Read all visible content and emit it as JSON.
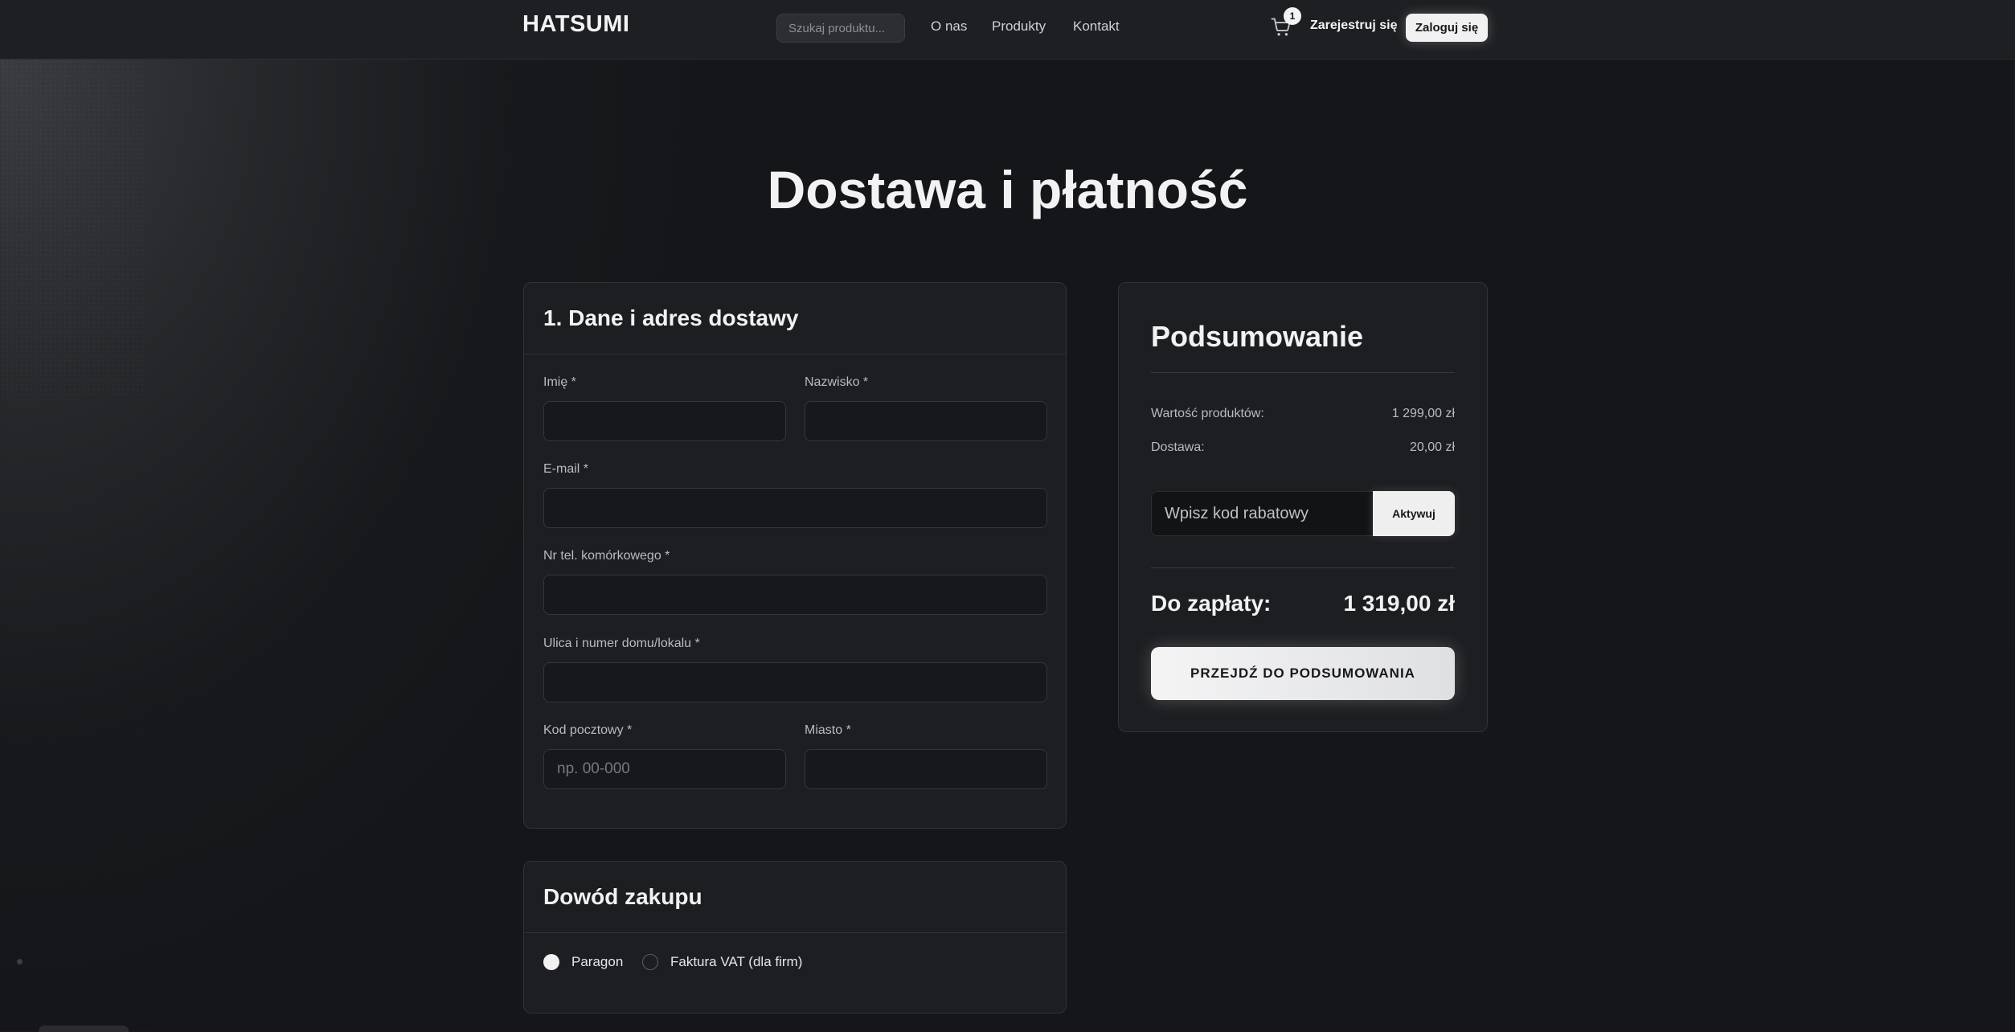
{
  "header": {
    "logo": "HATSUMI",
    "search_placeholder": "Szukaj produktu...",
    "nav": [
      "O nas",
      "Produkty",
      "Kontakt"
    ],
    "cart_icon": "cart-icon",
    "cart_count": "1",
    "register_label": "Zarejestruj się",
    "login_label": "Zaloguj się"
  },
  "page": {
    "title": "Dostawa i płatność"
  },
  "delivery": {
    "title": "1. Dane i adres dostawy",
    "fields": {
      "first_name": {
        "label": "Imię *",
        "value": "",
        "placeholder": ""
      },
      "last_name": {
        "label": "Nazwisko *",
        "value": "",
        "placeholder": ""
      },
      "email": {
        "label": "E-mail *",
        "value": "",
        "placeholder": ""
      },
      "phone": {
        "label": "Nr tel. komórkowego *",
        "value": "",
        "placeholder": ""
      },
      "street": {
        "label": "Ulica i numer domu/lokalu *",
        "value": "",
        "placeholder": ""
      },
      "postal": {
        "label": "Kod pocztowy *",
        "value": "",
        "placeholder": "np. 00-000"
      },
      "city": {
        "label": "Miasto *",
        "value": "",
        "placeholder": ""
      }
    }
  },
  "proof": {
    "title": "Dowód zakupu",
    "options": [
      {
        "label": "Paragon",
        "selected": true
      },
      {
        "label": "Faktura VAT (dla firm)",
        "selected": false
      }
    ]
  },
  "summary": {
    "title": "Podsumowanie",
    "products_label": "Wartość produktów:",
    "products_value": "1 299,00 zł",
    "shipping_label": "Dostawa:",
    "shipping_value": "20,00 zł",
    "coupon_placeholder": "Wpisz kod rabatowy",
    "coupon_button": "Aktywuj",
    "total_label": "Do zapłaty:",
    "total_value": "1 319,00 zł",
    "checkout_button": "PRZEJDŹ DO PODSUMOWANIA"
  },
  "colors": {
    "accent": "#f1f1f2",
    "background": "#141619",
    "card": "#1c1e21"
  }
}
